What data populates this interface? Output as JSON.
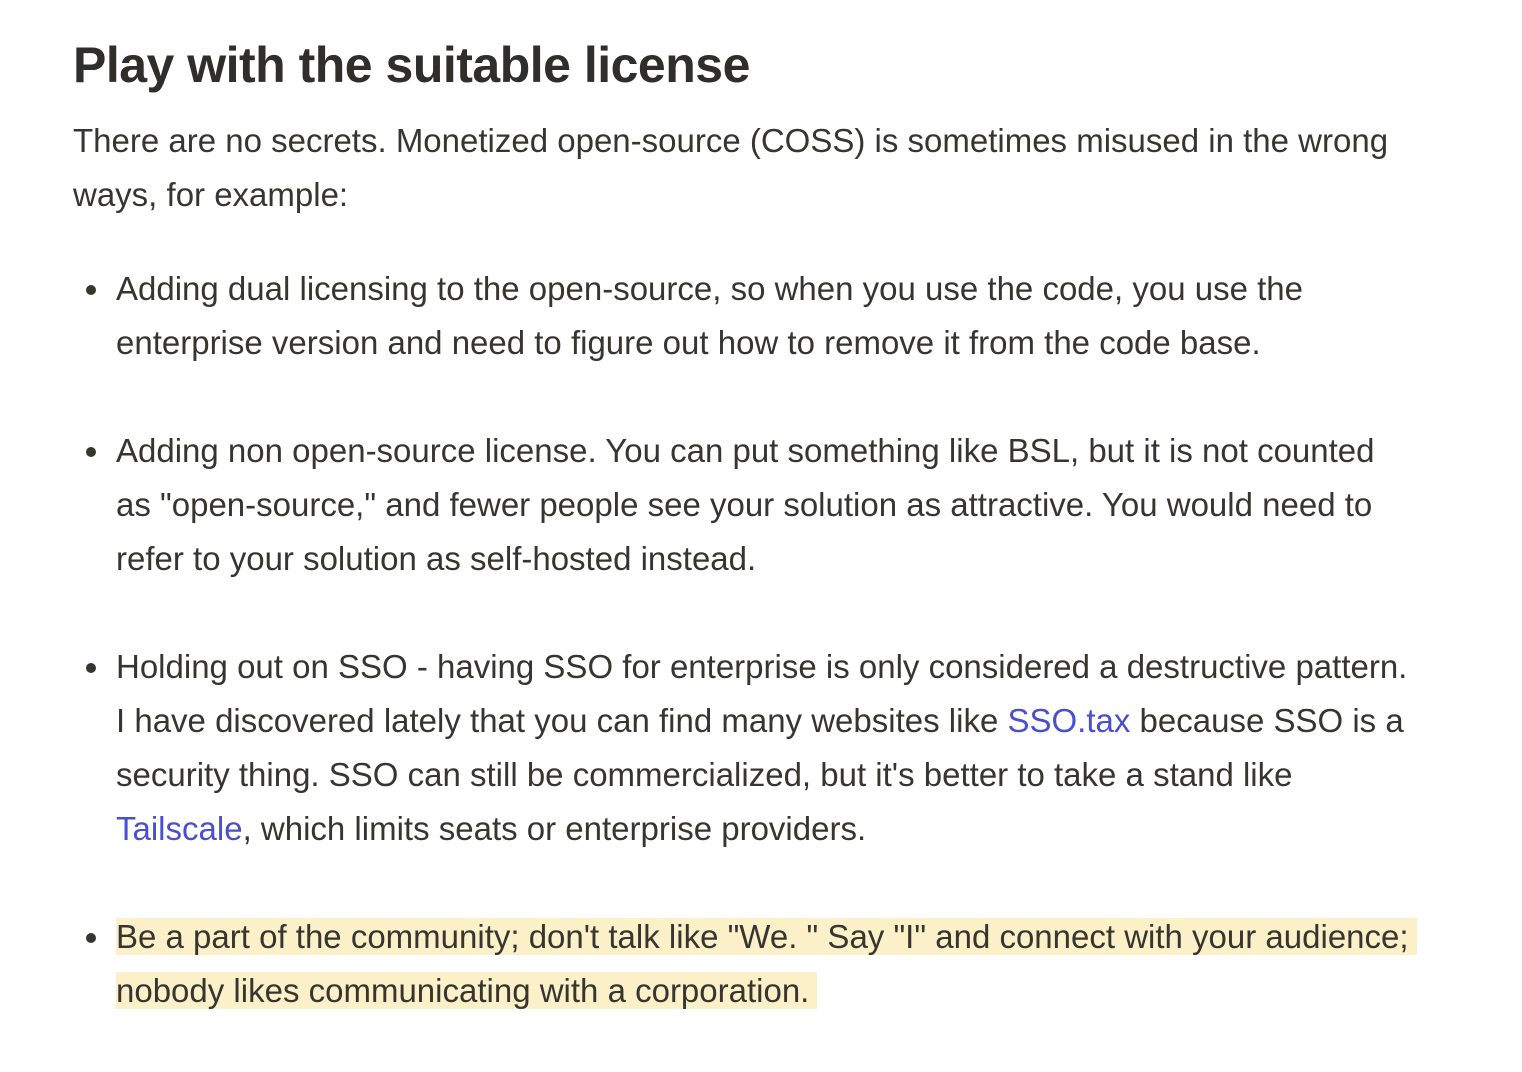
{
  "section": {
    "title": "Play with the suitable license",
    "intro": "There are no secrets. Monetized open-source (COSS) is sometimes misused in the wrong ways, for example:"
  },
  "points": {
    "p1": "Adding dual licensing to the open-source, so when you use the code, you use the enterprise version and need to figure out how to remove it from the code base.",
    "p2": "Adding non open-source license. You can put something like BSL, but it is not counted as \"open-source,\" and fewer people see your solution as attractive. You would need to refer to your solution as self-hosted instead.",
    "p3": {
      "before_link1": "Holding out on SSO - having SSO for enterprise is only considered a destructive pattern. I have discovered lately that you can find many websites like ",
      "link1": "SSO.tax",
      "between": " because SSO is a security thing. SSO can still be commercialized, but it's better to take a stand like ",
      "link2": "Tailscale",
      "after_link2": ", which limits seats or enterprise providers."
    },
    "p4": "Be a part of the community; don't talk like \"We. \" Say \"I\" and connect with your audience; nobody likes communicating with a corporation."
  },
  "colors": {
    "text": "#37352f",
    "link": "#4a4fcf",
    "highlight": "#fbf0c8"
  }
}
